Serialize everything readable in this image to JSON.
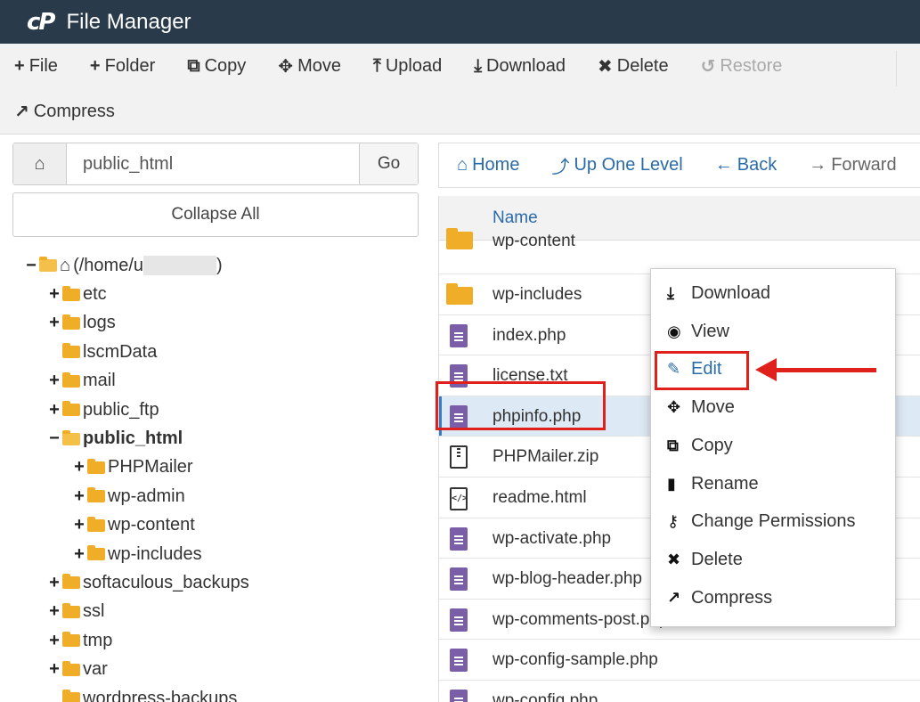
{
  "app": {
    "logo": "cP",
    "title": "File Manager"
  },
  "toolbar": {
    "row1": [
      {
        "icon": "+",
        "label": "File",
        "disabled": false
      },
      {
        "icon": "+",
        "label": "Folder",
        "disabled": false
      },
      {
        "icon": "⧉",
        "label": "Copy",
        "disabled": false
      },
      {
        "icon": "✥",
        "label": "Move",
        "disabled": false
      },
      {
        "icon": "⤒",
        "label": "Upload",
        "disabled": false
      },
      {
        "icon": "⤓",
        "label": "Download",
        "disabled": false
      },
      {
        "icon": "✖",
        "label": "Delete",
        "disabled": false
      },
      {
        "icon": "↺",
        "label": "Restore",
        "disabled": true
      }
    ],
    "row2": [
      {
        "icon": "↗",
        "label": "Compress",
        "disabled": false
      }
    ]
  },
  "path": {
    "value": "public_html",
    "go_label": "Go"
  },
  "collapse_label": "Collapse All",
  "tree": [
    {
      "indent": 0,
      "toggle": "−",
      "folder": "open",
      "label": "(/home/u",
      "redacted": true,
      "bold": false
    },
    {
      "indent": 1,
      "toggle": "+",
      "folder": "closed",
      "label": "etc",
      "bold": false
    },
    {
      "indent": 1,
      "toggle": "+",
      "folder": "closed",
      "label": "logs",
      "bold": false
    },
    {
      "indent": 1,
      "toggle": "",
      "folder": "closed",
      "label": "lscmData",
      "bold": false
    },
    {
      "indent": 1,
      "toggle": "+",
      "folder": "closed",
      "label": "mail",
      "bold": false
    },
    {
      "indent": 1,
      "toggle": "+",
      "folder": "closed",
      "label": "public_ftp",
      "bold": false
    },
    {
      "indent": 1,
      "toggle": "−",
      "folder": "open",
      "label": "public_html",
      "bold": true
    },
    {
      "indent": 2,
      "toggle": "+",
      "folder": "closed",
      "label": "PHPMailer",
      "bold": false
    },
    {
      "indent": 2,
      "toggle": "+",
      "folder": "closed",
      "label": "wp-admin",
      "bold": false
    },
    {
      "indent": 2,
      "toggle": "+",
      "folder": "closed",
      "label": "wp-content",
      "bold": false
    },
    {
      "indent": 2,
      "toggle": "+",
      "folder": "closed",
      "label": "wp-includes",
      "bold": false
    },
    {
      "indent": 1,
      "toggle": "+",
      "folder": "closed",
      "label": "softaculous_backups",
      "bold": false
    },
    {
      "indent": 1,
      "toggle": "+",
      "folder": "closed",
      "label": "ssl",
      "bold": false
    },
    {
      "indent": 1,
      "toggle": "+",
      "folder": "closed",
      "label": "tmp",
      "bold": false
    },
    {
      "indent": 1,
      "toggle": "+",
      "folder": "closed",
      "label": "var",
      "bold": false
    },
    {
      "indent": 1,
      "toggle": "",
      "folder": "closed",
      "label": "wordpress-backups",
      "bold": false
    }
  ],
  "nav": {
    "home": "Home",
    "up": "Up One Level",
    "back": "Back",
    "forward": "Forward"
  },
  "list": {
    "column_name": "Name",
    "rows": [
      {
        "name": "wp-content",
        "type": "folder",
        "partial": true,
        "selected": false
      },
      {
        "name": "wp-includes",
        "type": "folder",
        "partial": false,
        "selected": false
      },
      {
        "name": "index.php",
        "type": "doc",
        "partial": false,
        "selected": false
      },
      {
        "name": "license.txt",
        "type": "doc",
        "partial": false,
        "selected": false
      },
      {
        "name": "phpinfo.php",
        "type": "doc",
        "partial": false,
        "selected": true
      },
      {
        "name": "PHPMailer.zip",
        "type": "zip",
        "partial": false,
        "selected": false
      },
      {
        "name": "readme.html",
        "type": "code",
        "partial": false,
        "selected": false
      },
      {
        "name": "wp-activate.php",
        "type": "doc",
        "partial": false,
        "selected": false
      },
      {
        "name": "wp-blog-header.php",
        "type": "doc",
        "partial": false,
        "selected": false
      },
      {
        "name": "wp-comments-post.php",
        "type": "doc",
        "partial": false,
        "selected": false
      },
      {
        "name": "wp-config-sample.php",
        "type": "doc",
        "partial": false,
        "selected": false
      },
      {
        "name": "wp-config.php",
        "type": "doc",
        "partial": false,
        "selected": false
      }
    ]
  },
  "context_menu": [
    {
      "icon": "⤓",
      "label": "Download",
      "active": false
    },
    {
      "icon": "◉",
      "label": "View",
      "active": false
    },
    {
      "icon": "✎",
      "label": "Edit",
      "active": true
    },
    {
      "icon": "✥",
      "label": "Move",
      "active": false
    },
    {
      "icon": "⧉",
      "label": "Copy",
      "active": false
    },
    {
      "icon": "▮",
      "label": "Rename",
      "active": false
    },
    {
      "icon": "⚷",
      "label": "Change Permissions",
      "active": false
    },
    {
      "icon": "✖",
      "label": "Delete",
      "active": false
    },
    {
      "icon": "↗",
      "label": "Compress",
      "active": false
    }
  ],
  "colors": {
    "titlebar": "#293a4a",
    "link": "#2a6ba8",
    "folder": "#f0ad28",
    "doc": "#7a5ea8",
    "highlight": "#e0201b"
  }
}
